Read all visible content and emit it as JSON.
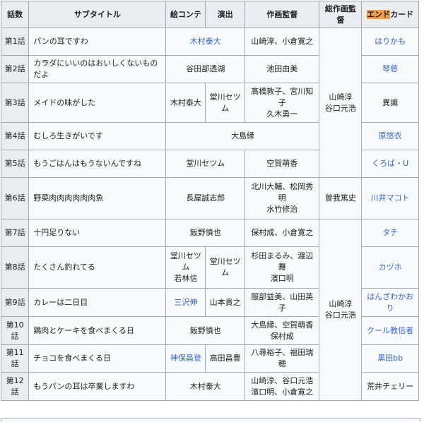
{
  "headers": {
    "ep": "話数",
    "subtitle": "サブタイトル",
    "storyboard": "絵コンテ",
    "director": "演出",
    "anim_dir": "作画監督",
    "chief_anim": "総作画監督",
    "endcard_hl": "エンド",
    "endcard_rest": "カード"
  },
  "chief": {
    "a": "山崎淳\n谷口元浩",
    "b": "曽我篤史",
    "c": "山崎淳\n谷口元浩"
  },
  "rows": [
    {
      "ep": "第1話",
      "title": "パンの耳ですわ",
      "sb_dir": "木村泰大",
      "ad": "山崎淳、小倉寛之",
      "card": "はりかも"
    },
    {
      "ep": "第2話",
      "title": "カラダにいいのはおいしくないものだよ",
      "sb_dir": "谷田部透湖",
      "ad": "池田由美",
      "card": "琴慈"
    },
    {
      "ep": "第3話",
      "title": "メイドの味がした",
      "sb": "木村泰大",
      "dir": "堂川セツム",
      "ad": "高橋敦子、宮川知子\n久木勇一",
      "card": "異識"
    },
    {
      "ep": "第4話",
      "title": "むしろ生きがいです",
      "sb_dir_ad": "大島縁",
      "card": "原悠衣"
    },
    {
      "ep": "第5話",
      "title": "もうごはんはもうないんですね",
      "sb_dir": "堂川セツム",
      "ad": "空賀萌香",
      "card": "くろば・U"
    },
    {
      "ep": "第6話",
      "title": "野菜肉肉肉肉肉肉魚",
      "sb_dir": "長屋誠志郎",
      "ad": "北川大輔、松岡秀明\n水竹修治",
      "card": "川井マコト"
    },
    {
      "ep": "第7話",
      "title": "十円足りない",
      "sb_dir": "飯野慎也",
      "ad": "保村成、小倉寛之",
      "card": "タチ"
    },
    {
      "ep": "第8話",
      "title": "たくさん釣れてる",
      "sb": "堂川セツム\n若林信",
      "dir": "堂川セツム",
      "ad": "杉田まるみ、渡辺舞\n濱口明",
      "card": "カヅホ"
    },
    {
      "ep": "第9話",
      "title": "カレーは二日目",
      "sb": "三沢伸",
      "dir": "山本貴之",
      "ad": "服部益美、山田英子",
      "card": "はんざわかおり"
    },
    {
      "ep": "第10話",
      "title": "鶏肉とケーキを食べまくる日",
      "sb_dir": "飯野慎也",
      "ad": "大島縁、空賀萌香\n保村成",
      "card": "クール教信者"
    },
    {
      "ep": "第11話",
      "title": "チョコを食べまくる日",
      "sb": "神保昌登",
      "dir": "高田昌豊",
      "ad": "八尋裕子、福田瑞穂",
      "card": "黒田bb"
    },
    {
      "ep": "第12話",
      "title": "もうパンの耳は卒業しますわ",
      "sb_dir": "木村泰大",
      "ad": "山崎淳、谷口元浩\n濱口明、小倉寛之",
      "card": "荒井チェリー"
    }
  ]
}
